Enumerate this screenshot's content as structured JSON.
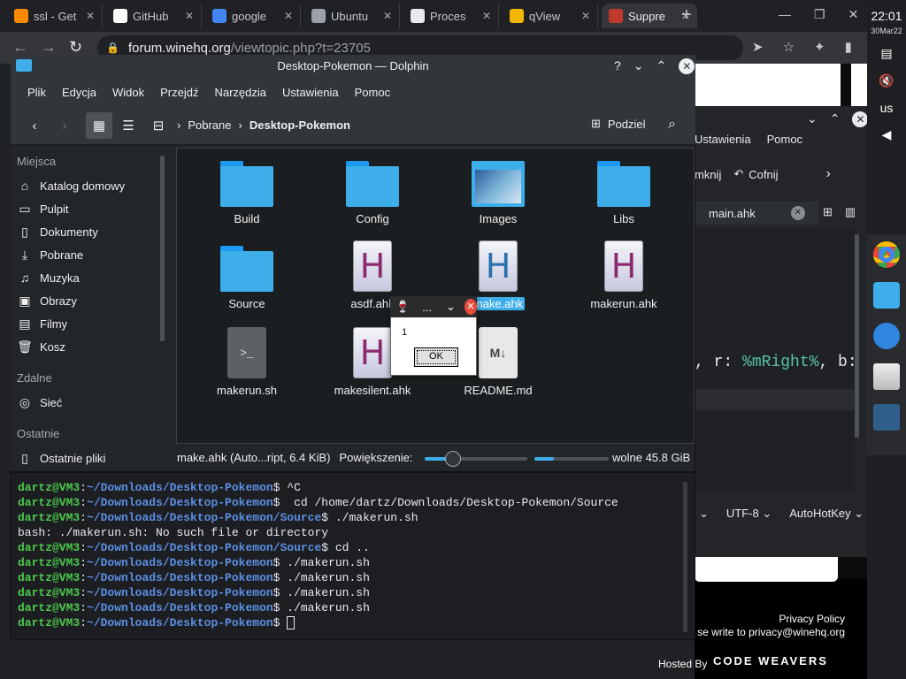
{
  "browser": {
    "tabs": [
      {
        "title": "ssl - Get",
        "color": "#ff8a00"
      },
      {
        "title": "GitHub",
        "color": "#ffffff"
      },
      {
        "title": "google",
        "color": "#4285f4"
      },
      {
        "title": "Ubuntu",
        "color": "#9aa0a6"
      },
      {
        "title": "Proces",
        "color": "#e8eaed"
      },
      {
        "title": "qView",
        "color": "#f2b705"
      },
      {
        "title": "Suppre",
        "color": "#c0392b"
      }
    ],
    "url_host": "forum.winehq.org",
    "url_path": "/viewtopic.php?t=23705"
  },
  "system": {
    "time": "22:01",
    "date": "30Mar22",
    "keyboard_layout": "us"
  },
  "webpage": {
    "privacy_policy": "Privacy Policy",
    "contact": "se write to privacy@winehq.org",
    "hosted_by": "Hosted By",
    "sponsor": "CODE WEAVERS"
  },
  "editor": {
    "menu": [
      "Ustawienia",
      "Pomoc"
    ],
    "toolbar": [
      "mknij",
      "Cofnij"
    ],
    "tab": "main.ahk",
    "code_plain1": ", r: ",
    "code_var": "%mRight%",
    "code_plain2": ", b:",
    "encoding": "UTF-8",
    "mode": "AutoHotKey"
  },
  "dolphin": {
    "title": "Desktop-Pokemon — Dolphin",
    "menu": [
      "Plik",
      "Edycja",
      "Widok",
      "Przejdź",
      "Narzędzia",
      "Ustawienia",
      "Pomoc"
    ],
    "breadcrumbs": [
      "Pobrane",
      "Desktop-Pokemon"
    ],
    "split_label": "Podziel",
    "sidebar": {
      "places_header": "Miejsca",
      "places": [
        {
          "label": "Katalog domowy",
          "icon": "⌂"
        },
        {
          "label": "Pulpit",
          "icon": "▭"
        },
        {
          "label": "Dokumenty",
          "icon": "▯"
        },
        {
          "label": "Pobrane",
          "icon": "⤓"
        },
        {
          "label": "Muzyka",
          "icon": "♫"
        },
        {
          "label": "Obrazy",
          "icon": "▣"
        },
        {
          "label": "Filmy",
          "icon": "▤"
        },
        {
          "label": "Kosz",
          "icon": "🗑"
        }
      ],
      "remote_header": "Zdalne",
      "remote": [
        {
          "label": "Sieć",
          "icon": "◎"
        }
      ],
      "recent_header": "Ostatnie",
      "recent": [
        {
          "label": "Ostatnie pliki",
          "icon": "▯"
        }
      ]
    },
    "files": [
      {
        "name": "Build",
        "type": "folder"
      },
      {
        "name": "Config",
        "type": "folder"
      },
      {
        "name": "Images",
        "type": "imgfolder"
      },
      {
        "name": "Libs",
        "type": "folder"
      },
      {
        "name": "Source",
        "type": "folder"
      },
      {
        "name": "asdf.ahk",
        "type": "ahk"
      },
      {
        "name": "make.ahk",
        "type": "ahk-selected"
      },
      {
        "name": "makerun.ahk",
        "type": "ahk"
      },
      {
        "name": "makerun.sh",
        "type": "sh"
      },
      {
        "name": "makesilent.ahk",
        "type": "ahk"
      },
      {
        "name": "README.md",
        "type": "md"
      }
    ],
    "status_file": "make.ahk (Auto...ript, 6.4 KiB)",
    "zoom_label": "Powiększenie:",
    "zoom_level": 0.28,
    "free_fraction": 0.26,
    "free_space": "wolne 45.8 GiB"
  },
  "msgbox": {
    "title": "...",
    "text": "1",
    "ok": "OK"
  },
  "terminal": {
    "lines": [
      {
        "user": "dartz@VM3",
        "path": "~/Downloads/Desktop-Pokemon",
        "cmd": "$ ^C"
      },
      {
        "user": "dartz@VM3",
        "path": "~/Downloads/Desktop-Pokemon",
        "cmd": "$  cd /home/dartz/Downloads/Desktop-Pokemon/Source"
      },
      {
        "user": "dartz@VM3",
        "path": "~/Downloads/Desktop-Pokemon/Source",
        "cmd": "$ ./makerun.sh"
      },
      {
        "output": "bash: ./makerun.sh: No such file or directory"
      },
      {
        "user": "dartz@VM3",
        "path": "~/Downloads/Desktop-Pokemon/Source",
        "cmd": "$ cd .."
      },
      {
        "user": "dartz@VM3",
        "path": "~/Downloads/Desktop-Pokemon",
        "cmd": "$ ./makerun.sh"
      },
      {
        "user": "dartz@VM3",
        "path": "~/Downloads/Desktop-Pokemon",
        "cmd": "$ ./makerun.sh"
      },
      {
        "user": "dartz@VM3",
        "path": "~/Downloads/Desktop-Pokemon",
        "cmd": "$ ./makerun.sh"
      },
      {
        "user": "dartz@VM3",
        "path": "~/Downloads/Desktop-Pokemon",
        "cmd": "$ ./makerun.sh"
      },
      {
        "user": "dartz@VM3",
        "path": "~/Downloads/Desktop-Pokemon",
        "cmd": "$ "
      }
    ]
  }
}
